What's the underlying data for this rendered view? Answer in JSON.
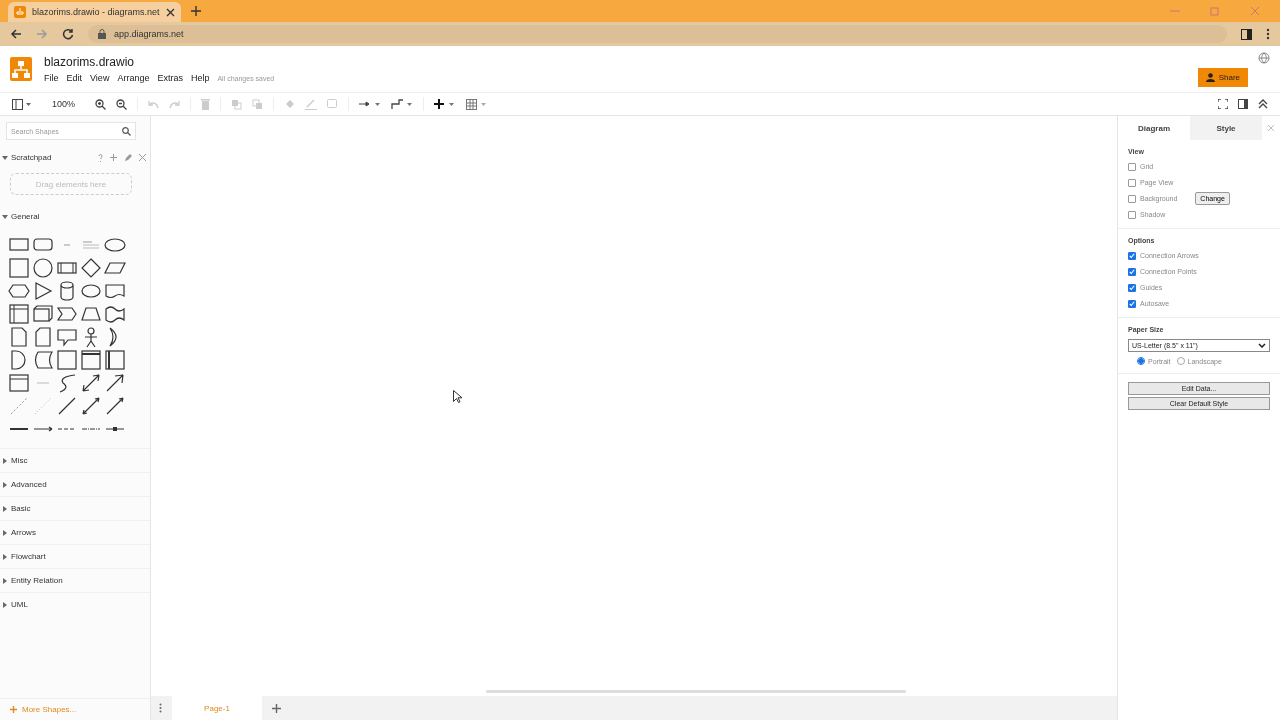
{
  "browser": {
    "tab_title": "blazorims.drawio - diagrams.net",
    "url": "app.diagrams.net"
  },
  "app": {
    "title": "blazorims.drawio",
    "menu": [
      "File",
      "Edit",
      "View",
      "Arrange",
      "Extras",
      "Help"
    ],
    "save_status": "All changes saved",
    "share_label": "Share"
  },
  "toolbar": {
    "zoom": "100%"
  },
  "sidebar": {
    "search_placeholder": "Search Shapes",
    "scratchpad": {
      "title": "Scratchpad",
      "drop_hint": "Drag elements here",
      "expanded": true
    },
    "sections": [
      {
        "title": "General",
        "expanded": true
      },
      {
        "title": "Misc",
        "expanded": false
      },
      {
        "title": "Advanced",
        "expanded": false
      },
      {
        "title": "Basic",
        "expanded": false
      },
      {
        "title": "Arrows",
        "expanded": false
      },
      {
        "title": "Flowchart",
        "expanded": false
      },
      {
        "title": "Entity Relation",
        "expanded": false
      },
      {
        "title": "UML",
        "expanded": false
      }
    ],
    "more_shapes": "More Shapes..."
  },
  "format_panel": {
    "tabs": [
      {
        "label": "Diagram",
        "selected": true
      },
      {
        "label": "Style",
        "selected": false
      }
    ],
    "view": {
      "heading": "View",
      "options": [
        {
          "label": "Grid",
          "checked": false
        },
        {
          "label": "Page View",
          "checked": false
        },
        {
          "label": "Background",
          "checked": false,
          "button": "Change"
        },
        {
          "label": "Shadow",
          "checked": false
        }
      ]
    },
    "options": {
      "heading": "Options",
      "items": [
        {
          "label": "Connection Arrows",
          "checked": true
        },
        {
          "label": "Connection Points",
          "checked": true
        },
        {
          "label": "Guides",
          "checked": true
        },
        {
          "label": "Autosave",
          "checked": true
        }
      ]
    },
    "paper_size": {
      "heading": "Paper Size",
      "value": "US-Letter (8.5\" x 11\")",
      "orientations": [
        {
          "label": "Portrait",
          "selected": true
        },
        {
          "label": "Landscape",
          "selected": false
        }
      ]
    },
    "buttons": [
      "Edit Data...",
      "Clear Default Style"
    ]
  },
  "pages": [
    {
      "label": "Page-1",
      "selected": true
    }
  ]
}
